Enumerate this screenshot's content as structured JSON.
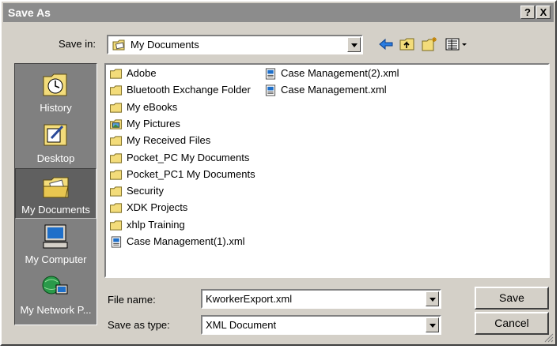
{
  "window": {
    "title": "Save As",
    "help_label": "?",
    "close_label": "X"
  },
  "toolbar": {
    "save_in_label": "Save in:",
    "save_in_value": "My Documents",
    "icons": [
      "back-arrow-icon",
      "up-folder-icon",
      "new-folder-icon",
      "views-menu-icon"
    ]
  },
  "places": [
    {
      "label": "History",
      "icon": "history-icon"
    },
    {
      "label": "Desktop",
      "icon": "desktop-icon"
    },
    {
      "label": "My Documents",
      "icon": "my-documents-icon",
      "selected": true
    },
    {
      "label": "My Computer",
      "icon": "my-computer-icon"
    },
    {
      "label": "My Network P...",
      "icon": "my-network-places-icon"
    }
  ],
  "files": {
    "column1": [
      {
        "name": "Adobe",
        "type": "folder"
      },
      {
        "name": "Bluetooth Exchange Folder",
        "type": "folder"
      },
      {
        "name": "My eBooks",
        "type": "folder"
      },
      {
        "name": "My Pictures",
        "type": "pictures-folder"
      },
      {
        "name": "My Received Files",
        "type": "folder"
      },
      {
        "name": "Pocket_PC My Documents",
        "type": "folder"
      },
      {
        "name": "Pocket_PC1 My Documents",
        "type": "folder"
      },
      {
        "name": "Security",
        "type": "folder"
      },
      {
        "name": "XDK Projects",
        "type": "folder"
      },
      {
        "name": "xhlp Training",
        "type": "folder"
      },
      {
        "name": "Case Management(1).xml",
        "type": "xml"
      }
    ],
    "column2": [
      {
        "name": "Case Management(2).xml",
        "type": "xml"
      },
      {
        "name": "Case Management.xml",
        "type": "xml"
      }
    ]
  },
  "form": {
    "file_name_label": "File name:",
    "file_name_value": "KworkerExport.xml",
    "save_type_label": "Save as type:",
    "save_type_value": "XML Document"
  },
  "buttons": {
    "save": "Save",
    "cancel": "Cancel"
  },
  "colors": {
    "titlebar": "#8c8c8c",
    "face": "#d4d0c8",
    "places_bar": "#808080"
  }
}
